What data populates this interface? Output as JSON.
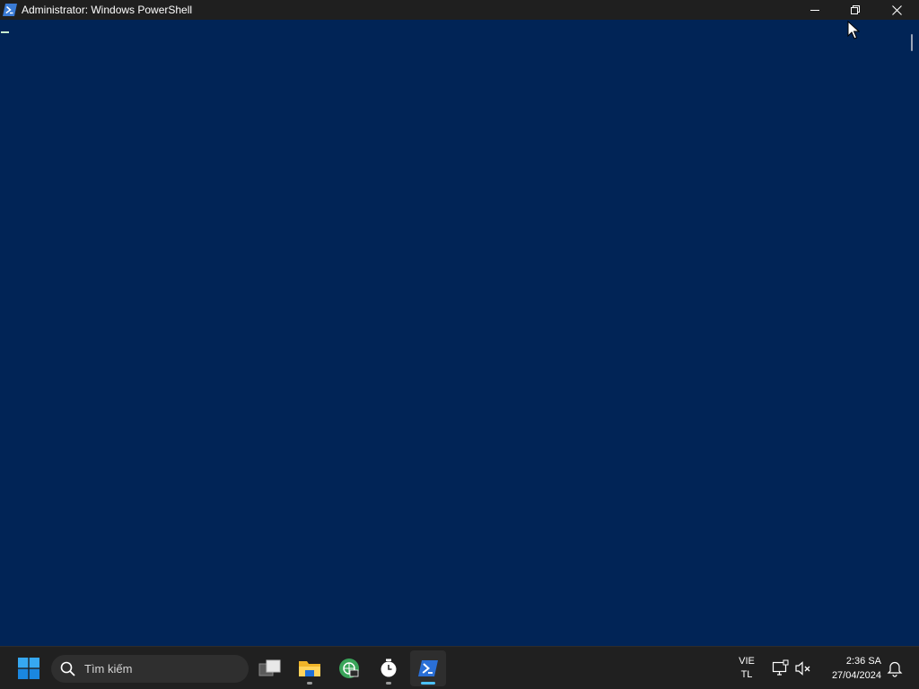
{
  "window": {
    "title": "Administrator: Windows PowerShell",
    "icon": "powershell-icon",
    "background": "#012456",
    "buttons": [
      "minimize-icon",
      "restore-icon",
      "close-icon"
    ]
  },
  "taskbar": {
    "start_icon": "windows-start-icon",
    "search": {
      "placeholder": "Tìm kiếm"
    },
    "apps": [
      {
        "name": "task-view-icon",
        "running": false
      },
      {
        "name": "file-explorer-icon",
        "running": true
      },
      {
        "name": "media-player-icon",
        "running": false
      },
      {
        "name": "clock-app-icon",
        "running": true
      },
      {
        "name": "powershell-icon",
        "running": true,
        "active": true
      }
    ],
    "language": {
      "line1": "VIE",
      "line2": "TL"
    },
    "tray_icons": [
      "network-icon",
      "volume-muted-icon"
    ],
    "clock": {
      "time": "2:36 SA",
      "date": "27/04/2024"
    },
    "notification_icon": "bell-icon"
  }
}
